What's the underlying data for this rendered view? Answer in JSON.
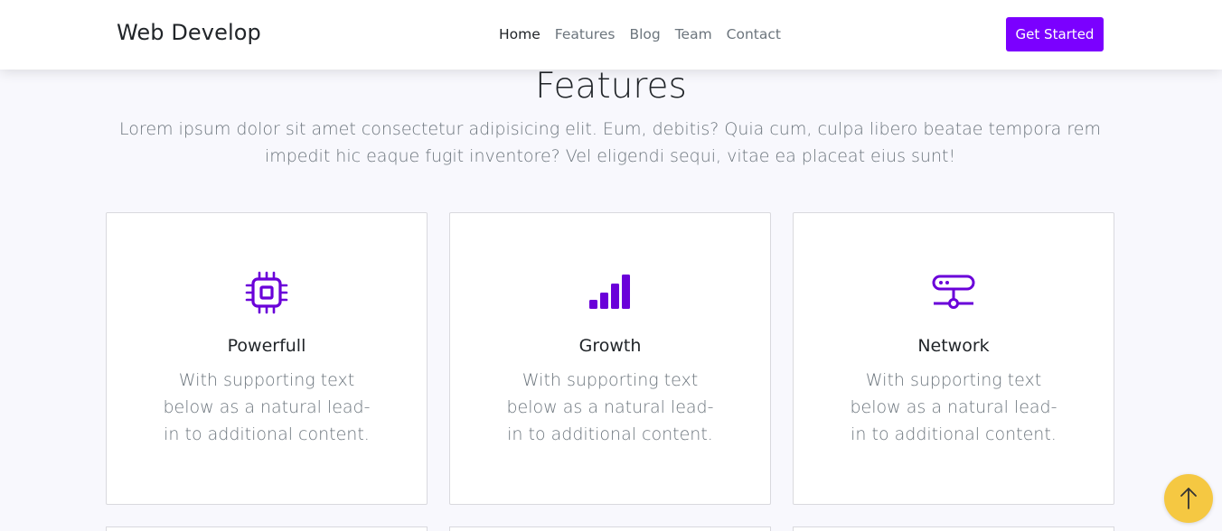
{
  "navbar": {
    "brand": "Web Develop",
    "links": [
      {
        "label": "Home",
        "active": true
      },
      {
        "label": "Features",
        "active": false
      },
      {
        "label": "Blog",
        "active": false
      },
      {
        "label": "Team",
        "active": false
      },
      {
        "label": "Contact",
        "active": false
      }
    ],
    "cta_label": "Get Started",
    "cta_color": "#7b00ff"
  },
  "section": {
    "title": "Features",
    "lead": "Lorem ipsum dolor sit amet consectetur adipisicing elit. Eum, debitis? Quia cum, culpa libero beatae tempora rem impedit hic eaque fugit inventore? Vel eligendi sequi, vitae ea placeat eius sunt!"
  },
  "features": [
    {
      "icon": "cpu-icon",
      "title": "Powerfull",
      "text": "With supporting text below as a natural lead-in to additional content."
    },
    {
      "icon": "bar-chart-icon",
      "title": "Growth",
      "text": "With supporting text below as a natural lead-in to additional content."
    },
    {
      "icon": "network-icon",
      "title": "Network",
      "text": "With supporting text below as a natural lead-in to additional content."
    }
  ],
  "icon_color": "#6a00d9",
  "back_to_top": {
    "icon": "arrow-up-icon",
    "color": "#f5c842"
  }
}
